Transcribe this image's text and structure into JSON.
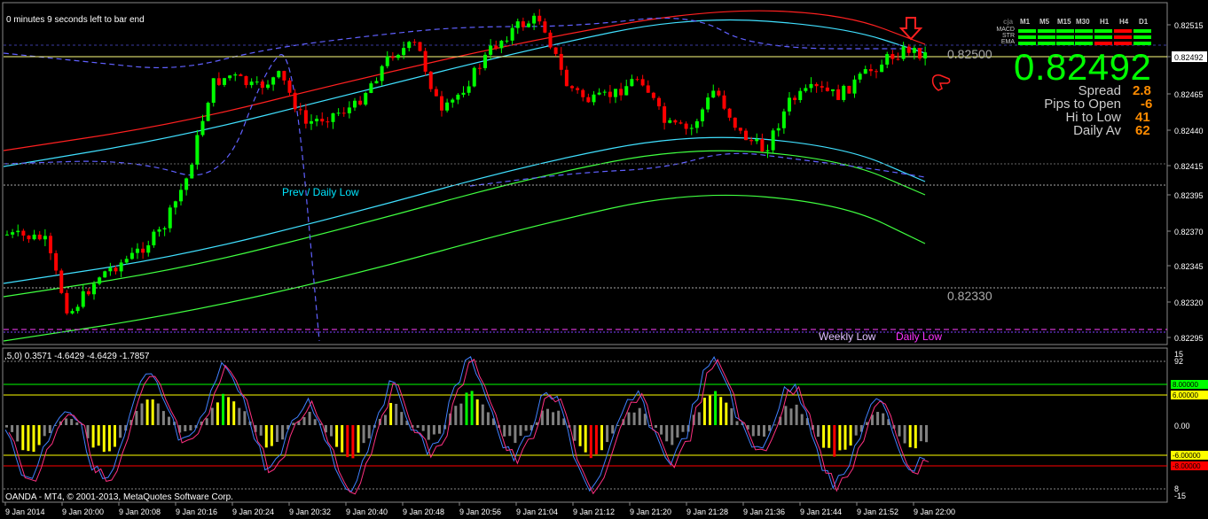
{
  "window": {
    "timer_text": "0 minutes 9 seconds left to bar end",
    "copyright": "OANDA - MT4, © 2001-2013, MetaQuotes Software Corp."
  },
  "price_axis": {
    "labels": [
      "0.82515",
      "0.82492",
      "0.82465",
      "0.82440",
      "0.82415",
      "0.82395",
      "0.82370",
      "0.82345",
      "0.82320",
      "0.82295"
    ],
    "current_price_label": "0.82492"
  },
  "levels": {
    "level_upper": "0.82500",
    "level_lower": "0.82330",
    "prev_daily_low": "Prev / Daily Low",
    "weekly_low": "Weekly Low",
    "daily_low": "Daily Low"
  },
  "info_panel": {
    "big_price": "0.82492",
    "rows": [
      {
        "label": "Spread",
        "value": "2.8"
      },
      {
        "label": "Pips to Open",
        "value": "-6"
      },
      {
        "label": "Hi to Low",
        "value": "41"
      },
      {
        "label": "Daily Av",
        "value": "62"
      }
    ],
    "brand": "cja",
    "timeframes": [
      "M1",
      "M5",
      "M15",
      "M30",
      "H1",
      "H4",
      "D1"
    ],
    "signal_rows": [
      "MACD",
      "STR",
      "EMA"
    ],
    "colors": {
      "up": "#00ff00",
      "down": "#ff0000"
    }
  },
  "indicator": {
    "label": ",5,0) 0.3571 -4.6429 -4.6429 -1.7857",
    "axis_labels": [
      "15",
      "92",
      "0.00",
      "8",
      "-15"
    ],
    "level_boxes": [
      "8.00000",
      "6.00000",
      "-6.00000",
      "-8.00000"
    ]
  },
  "time_axis": {
    "labels": [
      "9 Jan 2014",
      "9 Jan 20:00",
      "9 Jan 20:08",
      "9 Jan 20:16",
      "9 Jan 20:24",
      "9 Jan 20:32",
      "9 Jan 20:40",
      "9 Jan 20:48",
      "9 Jan 20:56",
      "9 Jan 21:04",
      "9 Jan 21:12",
      "9 Jan 21:20",
      "9 Jan 21:28",
      "9 Jan 21:36",
      "9 Jan 21:44",
      "9 Jan 21:52",
      "9 Jan 22:00"
    ]
  },
  "theme": {
    "background": "#000000",
    "bull_candle": "#00ff00",
    "bear_candle": "#ff0000",
    "band_red": "#ff2020",
    "band_cyan": "#40e0ff",
    "band_green": "#40ff40",
    "stoch_blue": "#4080ff",
    "stoch_pink": "#ff3080",
    "hist_gray": "#808080",
    "hist_yellow": "#ffff00"
  }
}
